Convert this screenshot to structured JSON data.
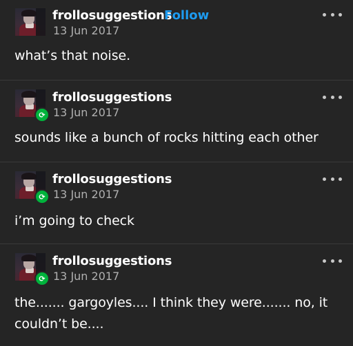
{
  "posts": [
    {
      "username": "frollosuggestions",
      "follow_label": "Follow",
      "date": "13 Jun 2017",
      "text": "what’s that noise.",
      "reblogged": false
    },
    {
      "username": "frollosuggestions",
      "date": "13 Jun 2017",
      "text": "sounds like a bunch of rocks hitting each other",
      "reblogged": true
    },
    {
      "username": "frollosuggestions",
      "date": "13 Jun 2017",
      "text": "i’m going to check",
      "reblogged": true
    },
    {
      "username": "frollosuggestions",
      "date": "13 Jun 2017",
      "text": "the....... gargoyles.... I think they were....... no, it couldn’t be....",
      "reblogged": true
    }
  ],
  "icons": {
    "reblog": "reblog-icon",
    "more": "more-options-icon"
  },
  "colors": {
    "background": "#252525",
    "follow": "#1d9bf0",
    "reblog_badge": "#00b33c",
    "date": "#b0b0b0"
  }
}
